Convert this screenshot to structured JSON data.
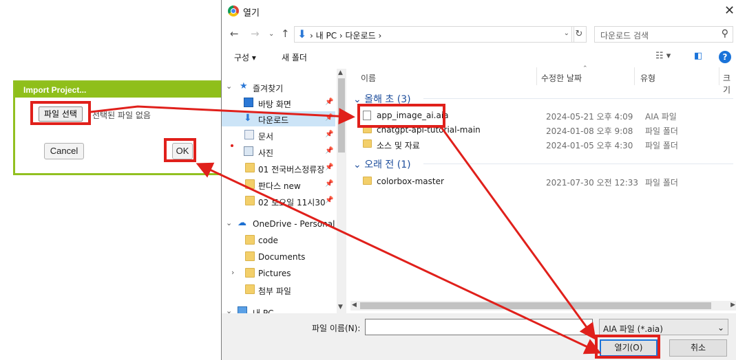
{
  "import_panel": {
    "title": "Import Project...",
    "file_button": "파일 선택",
    "no_file_text": "선택된 파일 없음",
    "cancel": "Cancel",
    "ok": "OK"
  },
  "dialog": {
    "title": "열기",
    "breadcrumb": "›  내 PC  ›  다운로드  ›",
    "search_placeholder": "다운로드 검색",
    "toolbar": {
      "organize": "구성 ▾",
      "new_folder": "새 폴더"
    },
    "nav": [
      {
        "label": "즐겨찾기",
        "icon": "star-icon"
      },
      {
        "label": "바탕 화면",
        "icon": "desktop-icon"
      },
      {
        "label": "다운로드",
        "icon": "download-icon"
      },
      {
        "label": "문서",
        "icon": "document-icon"
      },
      {
        "label": "사진",
        "icon": "pictures-icon"
      },
      {
        "label": "01 전국버스정류장",
        "icon": "folder-icon"
      },
      {
        "label": "판다스 new",
        "icon": "folder-icon"
      },
      {
        "label": "02 토요일 11시30",
        "icon": "folder-icon"
      },
      {
        "label": "OneDrive - Personal",
        "icon": "cloud-icon"
      },
      {
        "label": "code",
        "icon": "folder-icon"
      },
      {
        "label": "Documents",
        "icon": "folder-icon"
      },
      {
        "label": "Pictures",
        "icon": "folder-icon"
      },
      {
        "label": "첨부 파일",
        "icon": "folder-icon"
      },
      {
        "label": "내 PC",
        "icon": "pc-icon"
      }
    ],
    "columns": {
      "name": "이름",
      "date": "수정한 날짜",
      "type": "유형",
      "size": "크기"
    },
    "groups": [
      {
        "label": "올해 초 (3)",
        "files": [
          {
            "name": "app_image_ai.aia",
            "date": "2024-05-21 오후 4:09",
            "type": "AIA 파일"
          },
          {
            "name": "chatgpt-api-tutorial-main",
            "date": "2024-01-08 오후 9:08",
            "type": "파일 폴더"
          },
          {
            "name": "소스 및 자료",
            "date": "2024-01-05 오후 4:30",
            "type": "파일 폴더"
          }
        ]
      },
      {
        "label": "오래 전 (1)",
        "files": [
          {
            "name": "colorbox-master",
            "date": "2021-07-30 오전 12:33",
            "type": "파일 폴더"
          }
        ]
      }
    ],
    "footer": {
      "filename_label": "파일 이름(N):",
      "filename_value": "",
      "filetype": "AIA 파일 (*.aia)",
      "open": "열기(O)",
      "cancel": "취소"
    }
  },
  "colors": {
    "green": "#8fbf1a",
    "annotation_red": "#e0201b",
    "accent_blue": "#1a73d9"
  }
}
